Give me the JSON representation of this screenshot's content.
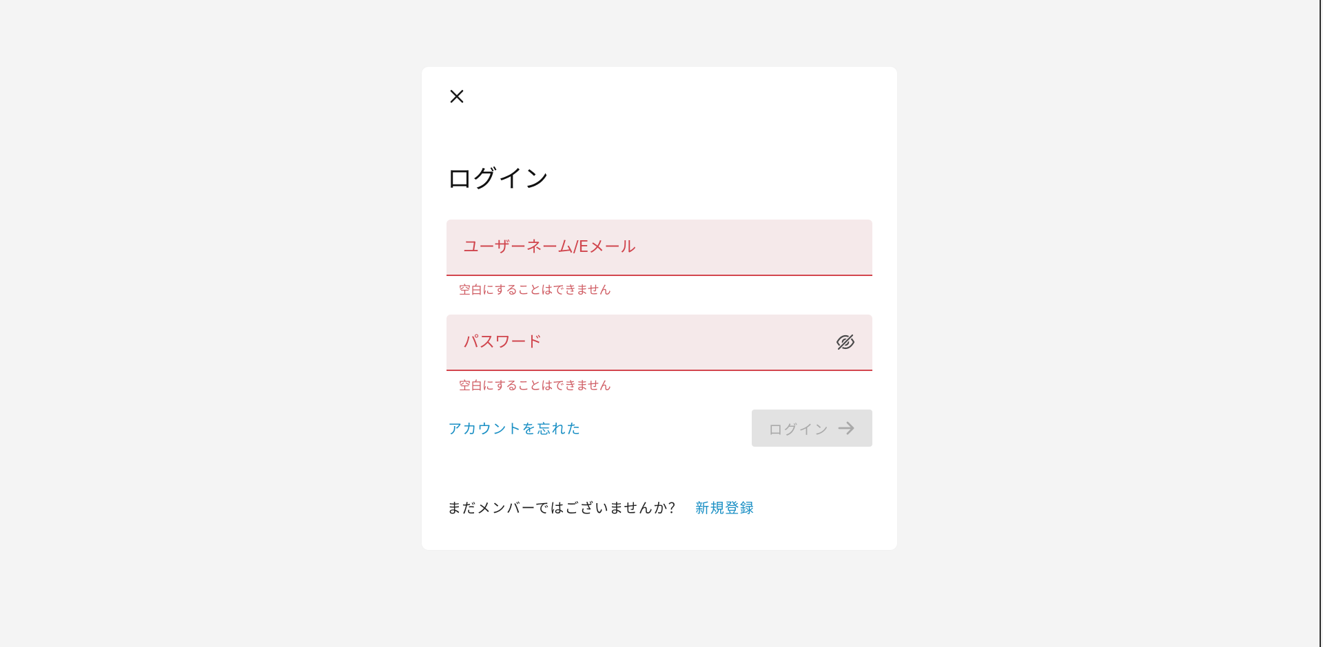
{
  "login_card": {
    "close_icon": "close-icon",
    "title": "ログイン",
    "username": {
      "placeholder": "ユーザーネーム/Eメール",
      "value": "",
      "error": "空白にすることはできません"
    },
    "password": {
      "placeholder": "パスワード",
      "value": "",
      "error": "空白にすることはできません",
      "toggle_icon": "eye-off-icon"
    },
    "forgot_link": "アカウントを忘れた",
    "login_button": {
      "label": "ログイン",
      "icon": "arrow-right-icon",
      "disabled": true
    },
    "footer": {
      "prompt": "まだメンバーではございませんか？",
      "signup_link": "新規登録"
    }
  },
  "colors": {
    "background": "#f4f4f4",
    "card": "#ffffff",
    "field_bg": "#f5e9ea",
    "error": "#d0454d",
    "link": "#1a8fc4",
    "button_disabled_bg": "#e2e2e2",
    "button_disabled_text": "#a9a9a9"
  }
}
